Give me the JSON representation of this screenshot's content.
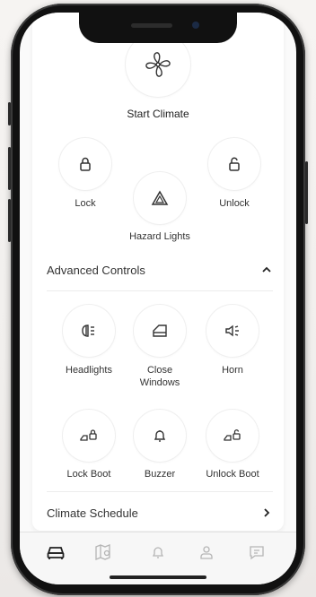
{
  "climate": {
    "start_label": "Start Climate"
  },
  "controls": {
    "lock_label": "Lock",
    "unlock_label": "Unlock",
    "hazard_label": "Hazard Lights"
  },
  "advanced": {
    "title": "Advanced Controls",
    "items": [
      {
        "label": "Headlights",
        "icon": "headlights-icon"
      },
      {
        "label": "Close\nWindows",
        "icon": "window-icon"
      },
      {
        "label": "Horn",
        "icon": "horn-icon"
      },
      {
        "label": "Lock Boot",
        "icon": "lock-boot-icon"
      },
      {
        "label": "Buzzer",
        "icon": "bell-icon"
      },
      {
        "label": "Unlock Boot",
        "icon": "unlock-boot-icon"
      }
    ]
  },
  "schedule": {
    "label": "Climate Schedule"
  },
  "tabs": [
    {
      "icon": "car-icon",
      "active": true
    },
    {
      "icon": "map-icon",
      "active": false
    },
    {
      "icon": "notifications-icon",
      "active": false
    },
    {
      "icon": "account-icon",
      "active": false
    },
    {
      "icon": "messages-icon",
      "active": false
    }
  ],
  "colors": {
    "accent": "#222222",
    "icon": "#555555",
    "inactive": "#b5b5b5"
  }
}
